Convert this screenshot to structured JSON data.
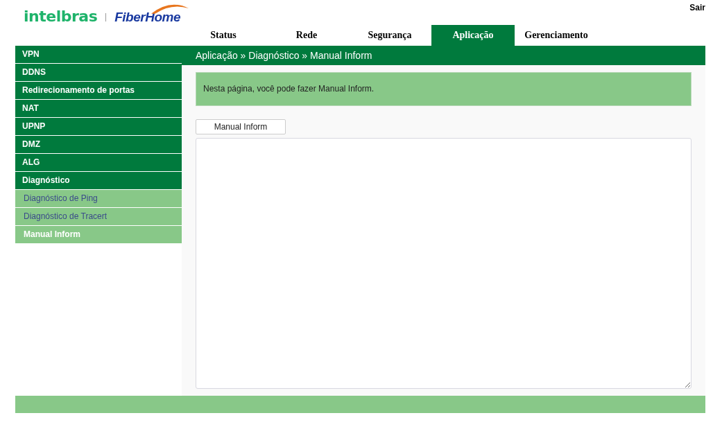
{
  "logo": {
    "brand": "intelbras",
    "partner": "FiberHome"
  },
  "logout": "Sair",
  "tabs": [
    {
      "label": "Status",
      "selected": false
    },
    {
      "label": "Rede",
      "selected": false
    },
    {
      "label": "Segurança",
      "selected": false
    },
    {
      "label": "Aplicação",
      "selected": true
    },
    {
      "label": "Gerenciamento",
      "selected": false
    }
  ],
  "sidebar": {
    "items": [
      {
        "label": "VPN",
        "selected": false
      },
      {
        "label": "DDNS",
        "selected": false
      },
      {
        "label": "Redirecionamento de portas",
        "selected": false
      },
      {
        "label": "NAT",
        "selected": false
      },
      {
        "label": "UPNP",
        "selected": false
      },
      {
        "label": "DMZ",
        "selected": false
      },
      {
        "label": "ALG",
        "selected": false
      },
      {
        "label": "Diagnóstico",
        "selected": false,
        "expanded": true,
        "children": [
          {
            "label": "Diagnóstico de Ping",
            "selected": false
          },
          {
            "label": "Diagnóstico de Tracert",
            "selected": false
          },
          {
            "label": "Manual Inform",
            "selected": true
          }
        ]
      }
    ]
  },
  "breadcrumb": "Aplicação » Diagnóstico » Manual Inform",
  "info": "Nesta página, você pode fazer Manual Inform.",
  "button": "Manual Inform"
}
